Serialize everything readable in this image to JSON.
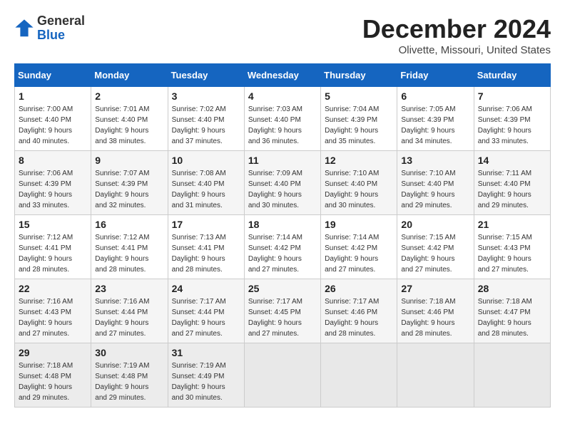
{
  "header": {
    "logo_general": "General",
    "logo_blue": "Blue",
    "month_title": "December 2024",
    "location": "Olivette, Missouri, United States"
  },
  "weekdays": [
    "Sunday",
    "Monday",
    "Tuesday",
    "Wednesday",
    "Thursday",
    "Friday",
    "Saturday"
  ],
  "weeks": [
    [
      {
        "day": "1",
        "sunrise": "7:00 AM",
        "sunset": "4:40 PM",
        "daylight": "9 hours and 40 minutes."
      },
      {
        "day": "2",
        "sunrise": "7:01 AM",
        "sunset": "4:40 PM",
        "daylight": "9 hours and 38 minutes."
      },
      {
        "day": "3",
        "sunrise": "7:02 AM",
        "sunset": "4:40 PM",
        "daylight": "9 hours and 37 minutes."
      },
      {
        "day": "4",
        "sunrise": "7:03 AM",
        "sunset": "4:40 PM",
        "daylight": "9 hours and 36 minutes."
      },
      {
        "day": "5",
        "sunrise": "7:04 AM",
        "sunset": "4:39 PM",
        "daylight": "9 hours and 35 minutes."
      },
      {
        "day": "6",
        "sunrise": "7:05 AM",
        "sunset": "4:39 PM",
        "daylight": "9 hours and 34 minutes."
      },
      {
        "day": "7",
        "sunrise": "7:06 AM",
        "sunset": "4:39 PM",
        "daylight": "9 hours and 33 minutes."
      }
    ],
    [
      {
        "day": "8",
        "sunrise": "7:06 AM",
        "sunset": "4:39 PM",
        "daylight": "9 hours and 33 minutes."
      },
      {
        "day": "9",
        "sunrise": "7:07 AM",
        "sunset": "4:39 PM",
        "daylight": "9 hours and 32 minutes."
      },
      {
        "day": "10",
        "sunrise": "7:08 AM",
        "sunset": "4:40 PM",
        "daylight": "9 hours and 31 minutes."
      },
      {
        "day": "11",
        "sunrise": "7:09 AM",
        "sunset": "4:40 PM",
        "daylight": "9 hours and 30 minutes."
      },
      {
        "day": "12",
        "sunrise": "7:10 AM",
        "sunset": "4:40 PM",
        "daylight": "9 hours and 30 minutes."
      },
      {
        "day": "13",
        "sunrise": "7:10 AM",
        "sunset": "4:40 PM",
        "daylight": "9 hours and 29 minutes."
      },
      {
        "day": "14",
        "sunrise": "7:11 AM",
        "sunset": "4:40 PM",
        "daylight": "9 hours and 29 minutes."
      }
    ],
    [
      {
        "day": "15",
        "sunrise": "7:12 AM",
        "sunset": "4:41 PM",
        "daylight": "9 hours and 28 minutes."
      },
      {
        "day": "16",
        "sunrise": "7:12 AM",
        "sunset": "4:41 PM",
        "daylight": "9 hours and 28 minutes."
      },
      {
        "day": "17",
        "sunrise": "7:13 AM",
        "sunset": "4:41 PM",
        "daylight": "9 hours and 28 minutes."
      },
      {
        "day": "18",
        "sunrise": "7:14 AM",
        "sunset": "4:42 PM",
        "daylight": "9 hours and 27 minutes."
      },
      {
        "day": "19",
        "sunrise": "7:14 AM",
        "sunset": "4:42 PM",
        "daylight": "9 hours and 27 minutes."
      },
      {
        "day": "20",
        "sunrise": "7:15 AM",
        "sunset": "4:42 PM",
        "daylight": "9 hours and 27 minutes."
      },
      {
        "day": "21",
        "sunrise": "7:15 AM",
        "sunset": "4:43 PM",
        "daylight": "9 hours and 27 minutes."
      }
    ],
    [
      {
        "day": "22",
        "sunrise": "7:16 AM",
        "sunset": "4:43 PM",
        "daylight": "9 hours and 27 minutes."
      },
      {
        "day": "23",
        "sunrise": "7:16 AM",
        "sunset": "4:44 PM",
        "daylight": "9 hours and 27 minutes."
      },
      {
        "day": "24",
        "sunrise": "7:17 AM",
        "sunset": "4:44 PM",
        "daylight": "9 hours and 27 minutes."
      },
      {
        "day": "25",
        "sunrise": "7:17 AM",
        "sunset": "4:45 PM",
        "daylight": "9 hours and 27 minutes."
      },
      {
        "day": "26",
        "sunrise": "7:17 AM",
        "sunset": "4:46 PM",
        "daylight": "9 hours and 28 minutes."
      },
      {
        "day": "27",
        "sunrise": "7:18 AM",
        "sunset": "4:46 PM",
        "daylight": "9 hours and 28 minutes."
      },
      {
        "day": "28",
        "sunrise": "7:18 AM",
        "sunset": "4:47 PM",
        "daylight": "9 hours and 28 minutes."
      }
    ],
    [
      {
        "day": "29",
        "sunrise": "7:18 AM",
        "sunset": "4:48 PM",
        "daylight": "9 hours and 29 minutes."
      },
      {
        "day": "30",
        "sunrise": "7:19 AM",
        "sunset": "4:48 PM",
        "daylight": "9 hours and 29 minutes."
      },
      {
        "day": "31",
        "sunrise": "7:19 AM",
        "sunset": "4:49 PM",
        "daylight": "9 hours and 30 minutes."
      },
      null,
      null,
      null,
      null
    ]
  ]
}
